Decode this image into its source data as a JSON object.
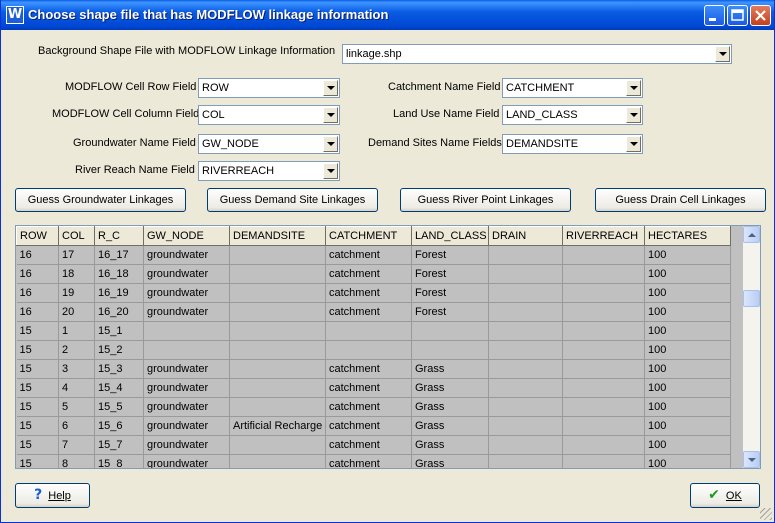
{
  "window": {
    "title": "Choose shape file that has MODFLOW linkage information",
    "app_icon_letter": "W"
  },
  "background": {
    "label": "Background Shape File with MODFLOW Linkage Information",
    "value": "linkage.shp"
  },
  "fields_left": [
    {
      "label": "MODFLOW Cell Row Field",
      "value": "ROW"
    },
    {
      "label": "MODFLOW Cell Column Field",
      "value": "COL"
    },
    {
      "label": "Groundwater Name Field",
      "value": "GW_NODE"
    },
    {
      "label": "River Reach Name Field",
      "value": "RIVERREACH"
    }
  ],
  "fields_right": [
    {
      "label": "Catchment Name Field",
      "value": "CATCHMENT"
    },
    {
      "label": "Land Use Name Field",
      "value": "LAND_CLASS"
    },
    {
      "label": "Demand Sites Name Fields",
      "value": "DEMANDSITE"
    }
  ],
  "buttons": {
    "guess_gw": "Guess Groundwater Linkages",
    "guess_demand": "Guess Demand Site Linkages",
    "guess_river": "Guess River Point Linkages",
    "guess_drain": "Guess Drain Cell Linkages",
    "help": "Help",
    "ok": "OK"
  },
  "table": {
    "columns": [
      "ROW",
      "COL",
      "R_C",
      "GW_NODE",
      "DEMANDSITE",
      "CATCHMENT",
      "LAND_CLASS",
      "DRAIN",
      "RIVERREACH",
      "HECTARES"
    ],
    "rows": [
      [
        "16",
        "17",
        "16_17",
        "groundwater",
        "",
        "catchment",
        "Forest",
        "",
        "",
        "100"
      ],
      [
        "16",
        "18",
        "16_18",
        "groundwater",
        "",
        "catchment",
        "Forest",
        "",
        "",
        "100"
      ],
      [
        "16",
        "19",
        "16_19",
        "groundwater",
        "",
        "catchment",
        "Forest",
        "",
        "",
        "100"
      ],
      [
        "16",
        "20",
        "16_20",
        "groundwater",
        "",
        "catchment",
        "Forest",
        "",
        "",
        "100"
      ],
      [
        "15",
        "1",
        "15_1",
        "",
        "",
        "",
        "",
        "",
        "",
        "100"
      ],
      [
        "15",
        "2",
        "15_2",
        "",
        "",
        "",
        "",
        "",
        "",
        "100"
      ],
      [
        "15",
        "3",
        "15_3",
        "groundwater",
        "",
        "catchment",
        "Grass",
        "",
        "",
        "100"
      ],
      [
        "15",
        "4",
        "15_4",
        "groundwater",
        "",
        "catchment",
        "Grass",
        "",
        "",
        "100"
      ],
      [
        "15",
        "5",
        "15_5",
        "groundwater",
        "",
        "catchment",
        "Grass",
        "",
        "",
        "100"
      ],
      [
        "15",
        "6",
        "15_6",
        "groundwater",
        "Artificial Recharge",
        "catchment",
        "Grass",
        "",
        "",
        "100"
      ],
      [
        "15",
        "7",
        "15_7",
        "groundwater",
        "",
        "catchment",
        "Grass",
        "",
        "",
        "100"
      ],
      [
        "15",
        "8",
        "15_8",
        "groundwater",
        "",
        "catchment",
        "Grass",
        "",
        "",
        "100"
      ]
    ]
  }
}
